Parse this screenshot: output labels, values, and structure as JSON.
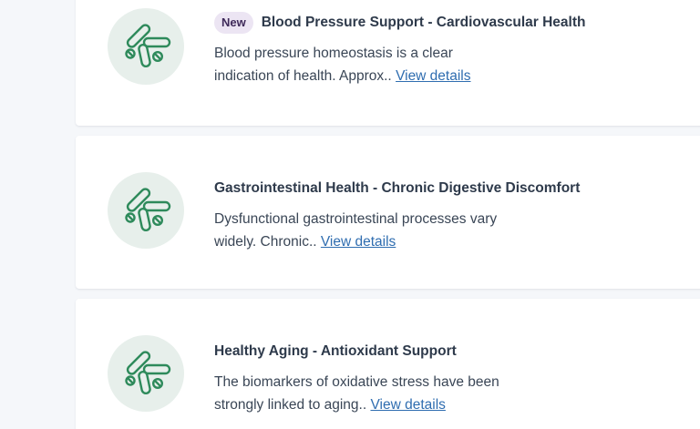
{
  "products": [
    {
      "badge": "New",
      "title": "Blood Pressure Support - Cardiovascular Health",
      "description": "Blood pressure homeostasis is a clear indication of health. Approx..",
      "link_label": "View details"
    },
    {
      "badge": "",
      "title": "Gastrointestinal Health - Chronic Digestive Discomfort",
      "description": "Dysfunctional gastrointestinal processes vary widely. Chronic..",
      "link_label": "View details"
    },
    {
      "badge": "",
      "title": "Healthy Aging - Antioxidant Support",
      "description": "The biomarkers of oxidative stress have been strongly linked to aging..",
      "link_label": "View details"
    }
  ],
  "colors": {
    "icon_stroke": "#2e8a5b",
    "icon_bg": "#e7efeb",
    "badge_bg": "#ece5f3",
    "link": "#2f6db0"
  },
  "icons": {
    "product": "pills-icon"
  }
}
